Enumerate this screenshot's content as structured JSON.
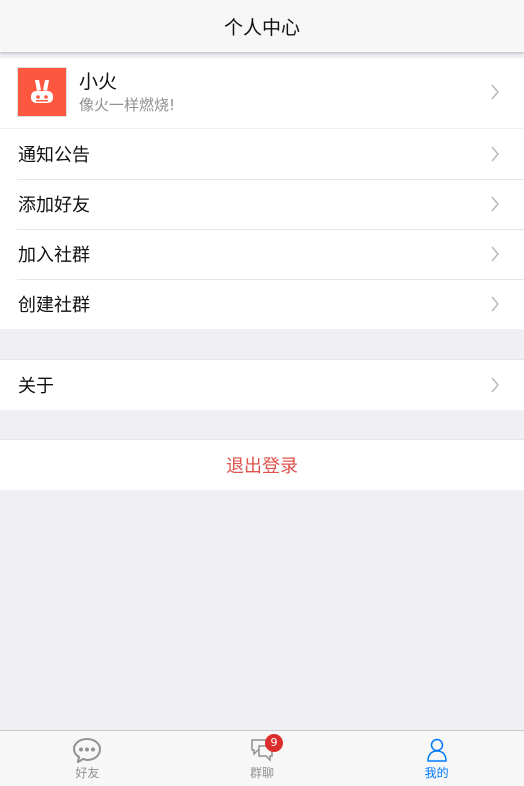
{
  "header": {
    "title": "个人中心"
  },
  "profile": {
    "name": "小火",
    "motto": "像火一样燃烧!"
  },
  "menu": [
    {
      "label": "通知公告"
    },
    {
      "label": "添加好友"
    },
    {
      "label": "加入社群"
    },
    {
      "label": "创建社群"
    }
  ],
  "about": {
    "label": "关于"
  },
  "logout": {
    "label": "退出登录",
    "color": "#dd524d"
  },
  "tabbar": {
    "tabs": [
      {
        "label": "好友",
        "icon": "chat-bubble-icon"
      },
      {
        "label": "群聊",
        "icon": "group-chat-icon",
        "badge": "9"
      },
      {
        "label": "我的",
        "icon": "person-icon",
        "active": true
      }
    ],
    "active_color": "#007aff"
  }
}
